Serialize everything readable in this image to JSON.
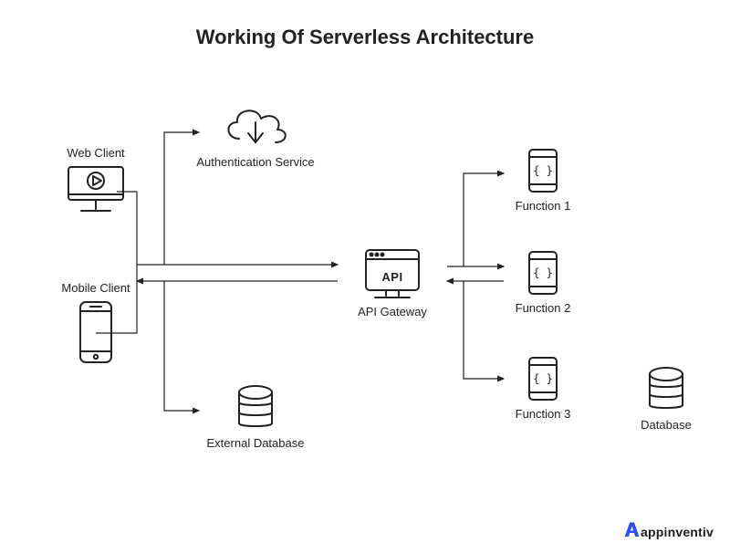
{
  "title": "Working Of Serverless Architecture",
  "nodes": {
    "web_client": "Web Client",
    "mobile_client": "Mobile Client",
    "authentication_service": "Authentication Service",
    "api_gateway": "API Gateway",
    "api_badge": "API",
    "external_database": "External Database",
    "function_1": "Function 1",
    "function_2": "Function 2",
    "function_3": "Function 3",
    "database": "Database"
  },
  "brand": {
    "initial": "A",
    "rest": "appinventiv"
  }
}
